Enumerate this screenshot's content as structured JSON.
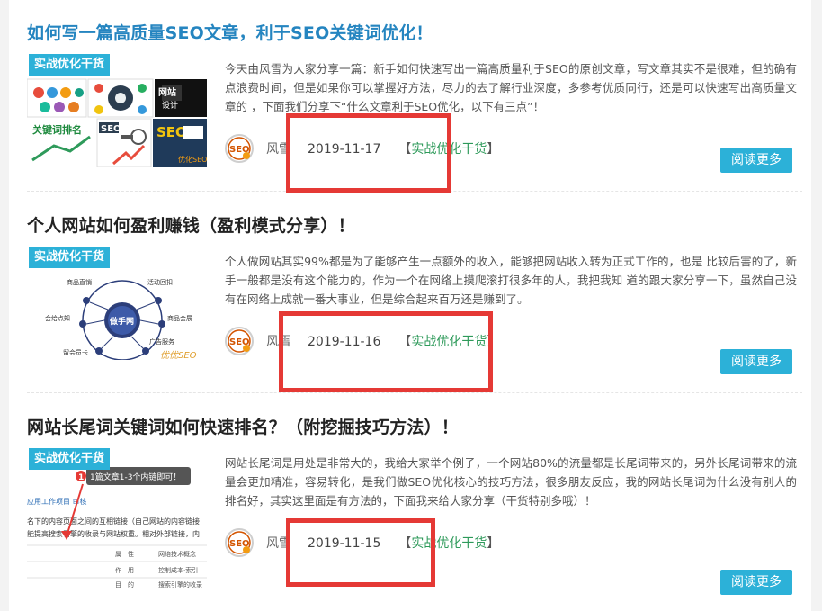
{
  "colors": {
    "accent": "#2cb1d8",
    "title_blue": "#2585c0",
    "title_dark": "#222222",
    "category_green": "#2e9a5a",
    "highlight_red": "#e53935"
  },
  "articles": [
    {
      "title": "如何写一篇高质量SEO文章，利于SEO关键词优化！",
      "tag": "实战优化干货",
      "excerpt": "今天由风雪为大家分享一篇：新手如何快速写出一篇高质量利于SEO的原创文章，写文章其实不是很难，但的确有 点浪费时间，但是如果你可以掌握好方法，尽力的去了解行业深度，多参考优质同行，还是可以快速写出高质量文章的 ，下面我们分享下“什么文章利于SEO优化，以下有三点”！",
      "author": "风雪",
      "date": "2019-11-17",
      "category": "实战优化干货",
      "read_more": "阅读更多",
      "thumb_text": {
        "w1": "网站",
        "w2": "设计",
        "k1": "关键词排名",
        "s1": "SEO",
        "s2": "SEO",
        "ds": "优化SEO"
      }
    },
    {
      "title": "个人网站如何盈利赚钱（盈利模式分享）！",
      "tag": "实战优化干货",
      "excerpt": "个人做网站其实99%都是为了能够产生一点额外的收入，能够把网站收入转为正式工作的，也是 比较后害的了，新手一般都是没有这个能力的，作为一个在网络上摸爬滚打很多年的人，我把我知 道的跟大家分享一下，虽然自己没有在网络上成就一番大事业，但是综合起来百万还是赚到了。",
      "author": "风雪",
      "date": "2019-11-16",
      "category": "实战优化干货",
      "read_more": "阅读更多",
      "thumb_text": {
        "center": "做手网",
        "n1": "商品直销",
        "n2": "活动回扣",
        "n3": "会给点知",
        "n4": "商品会展",
        "n5": "留会员卡",
        "n6": "广告服务",
        "wm": "优优SEO"
      }
    },
    {
      "title": "网站长尾词关键词如何快速排名？（附挖掘技巧方法）！",
      "tag": "实战优化干货",
      "excerpt": "网站长尾词是用处是非常大的，我给大家举个例子，一个网站80%的流量都是长尾词带来的，另外长尾词带来的流量会更加精准，容易转化，是我们做SEO优化核心的技巧方法，很多朋友反应，我的网站长尾词为什么没有别人的排名好，其实这里面是有方法的，下面我来给大家分享（干货特别多哦）！",
      "author": "风雪",
      "date": "2019-11-15",
      "category": "实战优化干货",
      "read_more": "阅读更多",
      "thumb_text": {
        "badge": "1",
        "tip": "1篇文章1-3个内链即可！",
        "l1": "应用工作项目 审核",
        "l2": "名下的内容页面之间的互相链接（自己网站的内容链接",
        "l3": "能提高搜索引擎的收录与网站权重。相对外部链接，内",
        "r1a": "属",
        "r1b": "性",
        "r1c": "网络技术概念",
        "r2a": "作",
        "r2b": "用",
        "r2c": "控制成本·索引",
        "r3a": "目",
        "r3b": "的",
        "r3c": "搜索引擎的收录"
      }
    }
  ],
  "ui": {
    "avatar_text": "SEO",
    "bracket_open": "【",
    "bracket_close": "】"
  }
}
